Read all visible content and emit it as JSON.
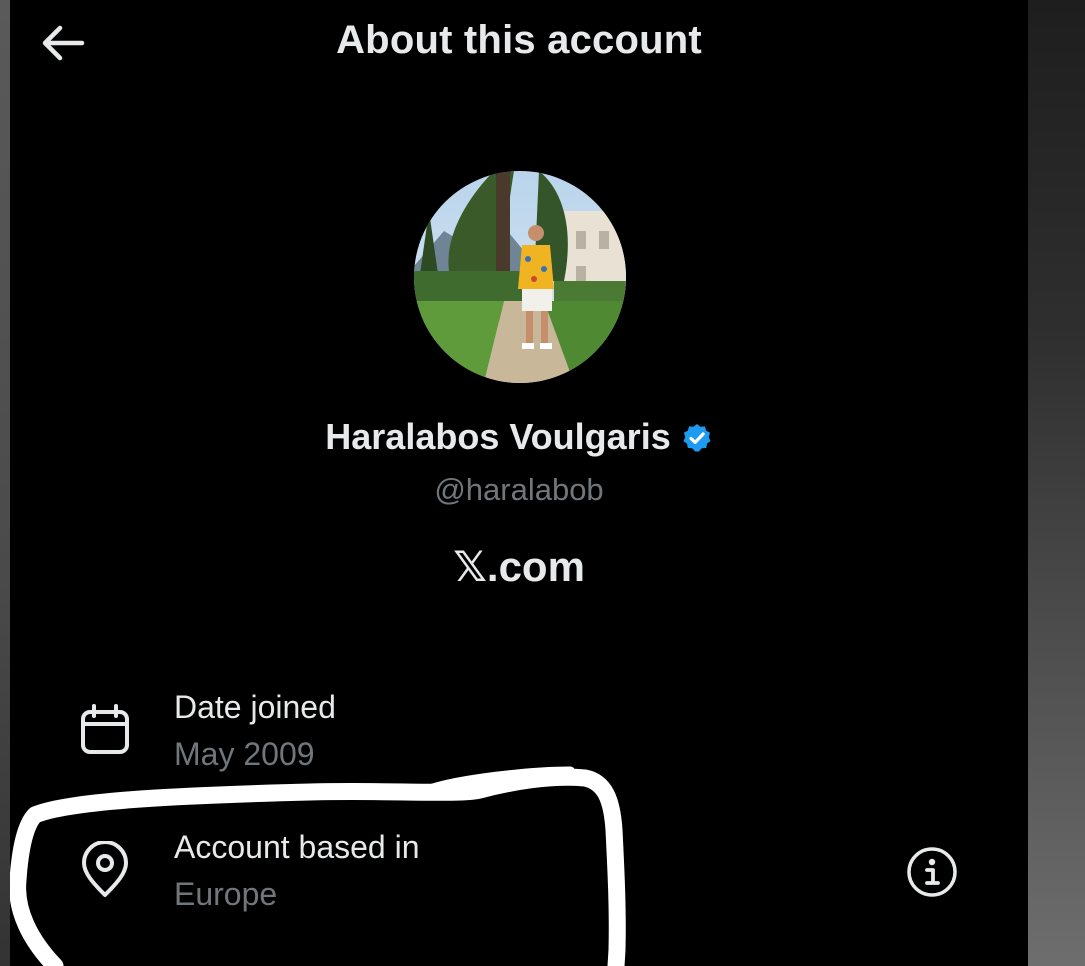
{
  "header": {
    "back_icon": "arrow-left-icon",
    "title": "About this account"
  },
  "profile": {
    "display_name": "Haralabos Voulgaris",
    "verified_icon": "verified-badge-icon",
    "verified_color": "#1d9bf0",
    "handle": "@haralabob",
    "via": "𝕏.com"
  },
  "rows": [
    {
      "icon": "calendar-icon",
      "label": "Date joined",
      "value": "May 2009"
    },
    {
      "icon": "location-pin-icon",
      "label": "Account based in",
      "value": "Europe",
      "info_icon": "info-icon"
    }
  ],
  "colors": {
    "background": "#000000",
    "primary_text": "#e7e9ea",
    "secondary_text": "#71767b",
    "annotation": "#ffffff"
  }
}
